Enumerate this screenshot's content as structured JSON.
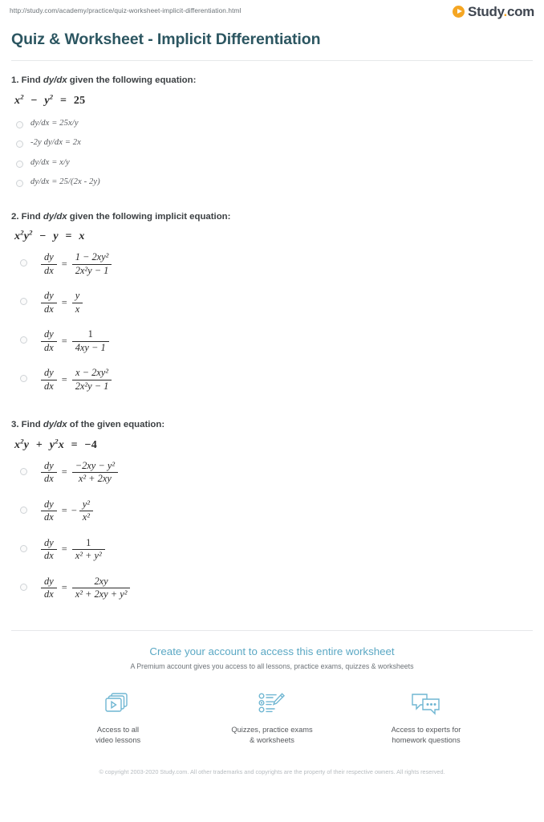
{
  "browser": {
    "url": "http://study.com/academy/practice/quiz-worksheet-implicit-differentiation.html"
  },
  "logo": {
    "name": "Study",
    "dot": ".",
    "tld": "com",
    "mark_icon": "play-circle-icon",
    "accent_color": "#f5a623",
    "text_color": "#3f4650"
  },
  "header": {
    "title": "Quiz & Worksheet - Implicit Differentiation",
    "title_color": "#2c5661"
  },
  "questions": [
    {
      "number": "1.",
      "prompt_before": "Find ",
      "prompt_italic": "dy/dx",
      "prompt_after": " given the following equation:",
      "equation_html": "x² − y² = 25",
      "options": [
        {
          "text": "dy/dx = 25x/y"
        },
        {
          "text": "-2y dy/dx = 2x"
        },
        {
          "text": "dy/dx = x/y"
        },
        {
          "text": "dy/dx = 25/(2x - 2y)"
        }
      ]
    },
    {
      "number": "2.",
      "prompt_before": "Find ",
      "prompt_italic": "dy/dx",
      "prompt_after": " given the following implicit equation:",
      "equation_html": "x²y² − y = x",
      "options": [
        {
          "lhs_top": "dy",
          "lhs_bot": "dx",
          "lead": "",
          "rhs_top": "1 − 2xy²",
          "rhs_bot": "2x²y − 1"
        },
        {
          "lhs_top": "dy",
          "lhs_bot": "dx",
          "lead": "",
          "rhs_top": "y",
          "rhs_bot": "x"
        },
        {
          "lhs_top": "dy",
          "lhs_bot": "dx",
          "lead": "",
          "rhs_top": "1",
          "rhs_bot": "4xy − 1"
        },
        {
          "lhs_top": "dy",
          "lhs_bot": "dx",
          "lead": "",
          "rhs_top": "x − 2xy²",
          "rhs_bot": "2x²y − 1"
        }
      ]
    },
    {
      "number": "3.",
      "prompt_before": "Find ",
      "prompt_italic": "dy/dx",
      "prompt_after": " of the given equation:",
      "equation_html": "x²y + y²x = −4",
      "options": [
        {
          "lhs_top": "dy",
          "lhs_bot": "dx",
          "lead": "",
          "rhs_top": "−2xy − y²",
          "rhs_bot": "x² + 2xy"
        },
        {
          "lhs_top": "dy",
          "lhs_bot": "dx",
          "lead": "−",
          "rhs_top": "y²",
          "rhs_bot": "x²"
        },
        {
          "lhs_top": "dy",
          "lhs_bot": "dx",
          "lead": "",
          "rhs_top": "1",
          "rhs_bot": "x² + y²"
        },
        {
          "lhs_top": "dy",
          "lhs_bot": "dx",
          "lead": "",
          "rhs_top": "2xy",
          "rhs_bot": "x² + 2xy + y²"
        }
      ]
    }
  ],
  "promo": {
    "title": "Create your account to access this entire worksheet",
    "subtitle": "A Premium account gives you access to all lessons, practice exams, quizzes & worksheets",
    "accent_color": "#5ba8c4",
    "features": [
      {
        "icon": "video-lessons-icon",
        "label": "Access to all\nvideo lessons"
      },
      {
        "icon": "quiz-pencil-icon",
        "label": "Quizzes, practice exams\n& worksheets"
      },
      {
        "icon": "chat-bubbles-icon",
        "label": "Access to experts for\nhomework questions"
      }
    ]
  },
  "footer": {
    "copyright": "© copyright 2003-2020 Study.com. All other trademarks and copyrights are the property of their respective owners. All rights reserved."
  }
}
